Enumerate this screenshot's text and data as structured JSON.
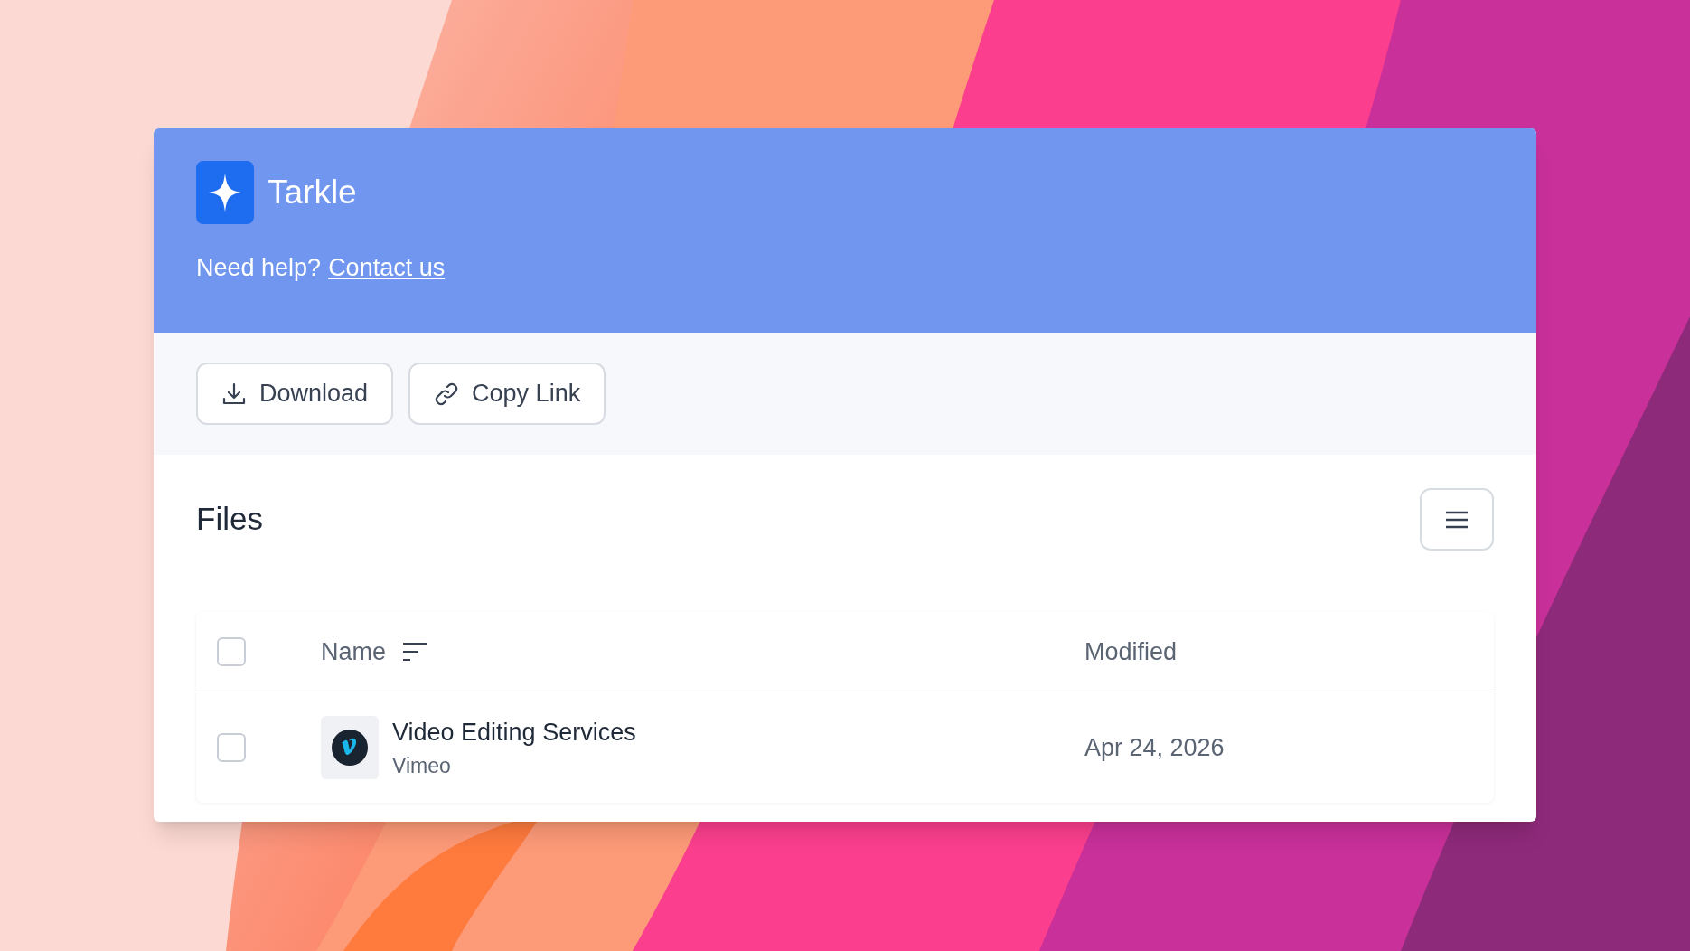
{
  "app": {
    "name": "Tarkle",
    "help_text": "Need help?",
    "help_link": "Contact us"
  },
  "actions": [
    {
      "kind": "download",
      "label": "Download"
    },
    {
      "kind": "link",
      "label": "Copy Link"
    }
  ],
  "files": {
    "title": "Files",
    "columns": [
      "Name",
      "Modified"
    ],
    "all_checked": false,
    "rows": [
      {
        "name": "Video Editing Services",
        "source": "Vimeo",
        "modified": "Apr 24, 2026",
        "checked": false
      }
    ]
  }
}
